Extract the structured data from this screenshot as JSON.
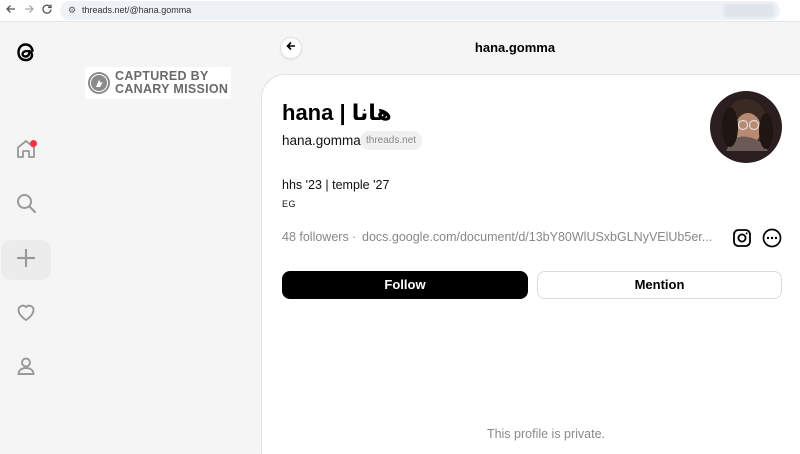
{
  "browser": {
    "url": "threads.net/@hana.gomma"
  },
  "icons": [
    "back-arrow-icon",
    "forward-arrow-icon",
    "reload-icon",
    "site-settings-icon",
    "threads-logo-icon",
    "home-icon",
    "search-icon",
    "plus-icon",
    "heart-icon",
    "person-icon",
    "bird-icon",
    "instagram-icon",
    "more-icon",
    "avatar"
  ],
  "watermark": {
    "line1": "CAPTURED BY",
    "line2": "CANARY MISSION"
  },
  "header": {
    "title": "hana.gomma"
  },
  "profile": {
    "name": "hana | هانا",
    "username": "hana.gomma",
    "host_badge": "threads.net",
    "bio": "hhs '23 | temple '27",
    "bio_tag": "EG",
    "followers": "48 followers",
    "separator": "·",
    "link": "docs.google.com/document/d/13bY80WlUSxbGLNyVElUb5er..."
  },
  "buttons": {
    "follow": "Follow",
    "mention": "Mention"
  },
  "status": {
    "private": "This profile is private."
  },
  "colors": {
    "notification": "#ff3040",
    "follow_bg": "#000000"
  }
}
